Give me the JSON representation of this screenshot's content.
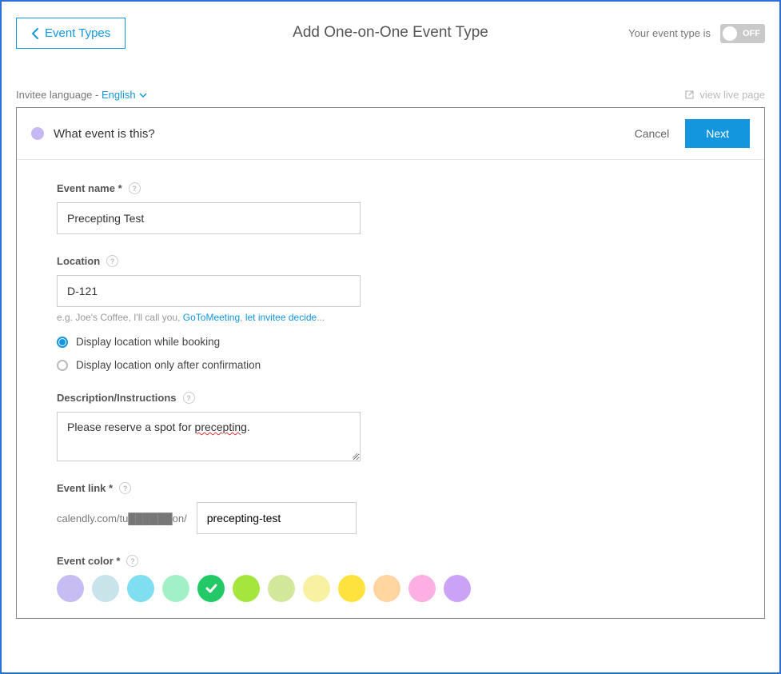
{
  "header": {
    "back_label": "Event Types",
    "title": "Add One-on-One Event Type",
    "status_label": "Your event type is",
    "toggle_value": "OFF"
  },
  "subheader": {
    "lang_label": "Invitee language - ",
    "lang_value": "English",
    "view_live_label": "view live page"
  },
  "panel": {
    "title": "What event is this?",
    "cancel_label": "Cancel",
    "next_label": "Next"
  },
  "form": {
    "event_name": {
      "label": "Event name *",
      "value": "Precepting Test"
    },
    "location": {
      "label": "Location",
      "value": "D-121",
      "hint_prefix": "e.g. Joe's Coffee, I'll call you, ",
      "hint_link1": "GoToMeeting",
      "hint_sep": ", ",
      "hint_link2": "let invitee decide",
      "hint_suffix": "...",
      "radio1": "Display location while booking",
      "radio2": "Display location only after confirmation",
      "radio_selected": 0
    },
    "description": {
      "label": "Description/Instructions",
      "text_before": "Please reserve a spot for ",
      "text_word": "precepting",
      "text_after": "."
    },
    "event_link": {
      "label": "Event link *",
      "prefix": "calendly.com/tu██████on/",
      "value": "precepting-test"
    },
    "event_color": {
      "label": "Event color *",
      "selected_index": 4,
      "colors": [
        "#c7bdf3",
        "#c8e3ea",
        "#7fdff0",
        "#a2f0c8",
        "#23c966",
        "#a5e63e",
        "#d3e79a",
        "#f7f1a1",
        "#ffe23d",
        "#ffd6a0",
        "#ffaee4",
        "#caa3f7"
      ]
    }
  }
}
